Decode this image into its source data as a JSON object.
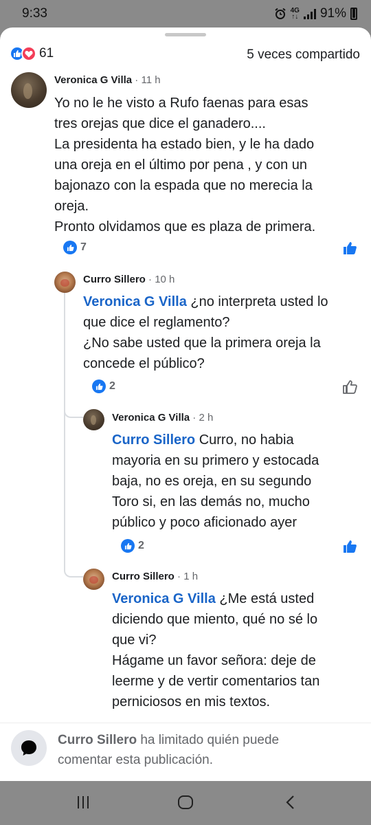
{
  "status": {
    "time": "9:33",
    "network_top": "4G",
    "network_bottom": "↑↓",
    "battery": "91%"
  },
  "header": {
    "reaction_count": "61",
    "shares": "5 veces compartido"
  },
  "comments": [
    {
      "author": "Veronica G Villa",
      "time": "· 11 h",
      "lines": [
        "Yo no le he visto a Rufo faenas para esas",
        "tres orejas que dice el ganadero....",
        "La presidenta ha estado bien, y le ha dado",
        "una oreja en el último por pena , y con un",
        "bajonazo con la espada que no merecia la",
        "oreja.",
        "Pronto olvidamos que es plaza de primera."
      ],
      "likes": "7"
    },
    {
      "author": "Curro Sillero",
      "time": "· 10 h",
      "mention": "Veronica G Villa",
      "first_line_rest": "¿no interpreta usted lo",
      "lines": [
        "que dice el reglamento?",
        "¿No sabe usted que la primera oreja la",
        "concede el público?"
      ],
      "likes": "2"
    },
    {
      "author": "Veronica G Villa",
      "time": "· 2 h",
      "mention": "Curro Sillero",
      "first_line_rest": "Curro, no habia",
      "lines": [
        "mayoria en su primero y estocada",
        "baja, no es oreja, en su segundo",
        "Toro si, en las demás no, mucho",
        "público y poco aficionado ayer"
      ],
      "likes": "2"
    },
    {
      "author": "Curro Sillero",
      "time": "· 1 h",
      "mention": "Veronica G Villa",
      "first_line_rest": "¿Me está usted",
      "lines": [
        "diciendo que miento, qué no sé lo",
        "que vi?",
        "Hágame un favor señora: deje de",
        "leerme y de vertir comentarios tan",
        "perniciosos en mis textos."
      ]
    }
  ],
  "limit_notice": {
    "name": "Curro Sillero",
    "text_line1": "ha limitado quién puede",
    "text_line2": "comentar esta publicación."
  },
  "colors": {
    "accent": "#1877f2",
    "mention": "#1a65c8",
    "love": "#f33e58"
  },
  "icons": [
    "like-reaction-icon",
    "love-reaction-icon",
    "like-icon",
    "comment-bubble-icon",
    "recents-icon",
    "home-icon",
    "back-icon",
    "alarm-icon",
    "signal-icon",
    "battery-icon"
  ]
}
